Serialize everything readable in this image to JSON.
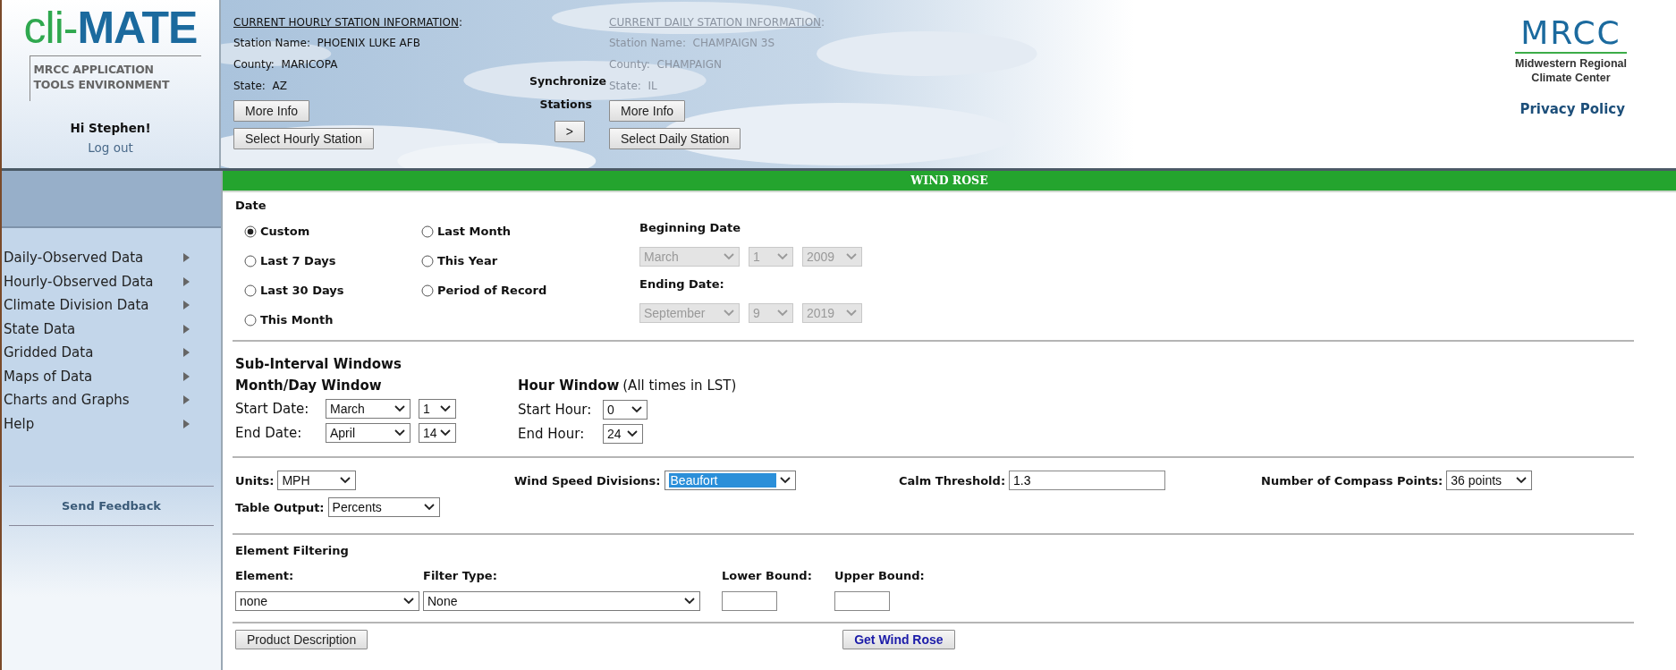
{
  "header": {
    "logo": {
      "prefix": "cli-",
      "main": "MATE"
    },
    "subtitle": [
      "MRCC APPLICATION",
      "TOOLS ENVIRONMENT"
    ],
    "greeting": "Hi Stephen!",
    "logout": "Log out",
    "hourly": {
      "heading": "CURRENT HOURLY STATION INFORMATION",
      "suffix": ":",
      "dimmed": false,
      "fields": [
        {
          "label": "Station Name:",
          "value": "PHOENIX LUKE AFB"
        },
        {
          "label": "County:",
          "value": "MARICOPA"
        },
        {
          "label": "State:",
          "value": "AZ"
        }
      ],
      "buttons": [
        "More Info",
        "Select Hourly Station"
      ]
    },
    "sync": {
      "lines": [
        "Synchronize",
        "Stations"
      ],
      "button": ">"
    },
    "daily": {
      "heading": "CURRENT DAILY STATION INFORMATION",
      "suffix": ":",
      "dimmed": true,
      "fields": [
        {
          "label": "Station Name:",
          "value": "CHAMPAIGN 3S"
        },
        {
          "label": "County:",
          "value": "CHAMPAIGN"
        },
        {
          "label": "State:",
          "value": "IL"
        }
      ],
      "buttons": [
        "More Info",
        "Select Daily Station"
      ]
    },
    "org": {
      "name": "MRCC",
      "lines": [
        "Midwestern Regional",
        "Climate Center"
      ]
    },
    "privacy": "Privacy Policy"
  },
  "sidebar": {
    "items": [
      "Daily-Observed Data",
      "Hourly-Observed Data",
      "Climate Division Data",
      "State Data",
      "Gridded Data",
      "Maps of Data",
      "Charts and Graphs",
      "Help"
    ],
    "feedback": "Send Feedback"
  },
  "title": "WIND ROSE",
  "date": {
    "label": "Date",
    "options": [
      {
        "label": "Custom",
        "selected": true
      },
      {
        "label": "Last 7 Days",
        "selected": false
      },
      {
        "label": "Last 30 Days",
        "selected": false
      },
      {
        "label": "This Month",
        "selected": false
      },
      {
        "label": "Last Month",
        "selected": false
      },
      {
        "label": "This Year",
        "selected": false
      },
      {
        "label": "Period of Record",
        "selected": false
      }
    ],
    "beginning": {
      "label": "Beginning Date",
      "selects": [
        {
          "value": "March",
          "disabled": true
        },
        {
          "value": "1",
          "disabled": true
        },
        {
          "value": "2009",
          "disabled": true
        }
      ]
    },
    "ending": {
      "label": "Ending Date:",
      "selects": [
        {
          "value": "September",
          "disabled": true
        },
        {
          "value": "9",
          "disabled": true
        },
        {
          "value": "2019",
          "disabled": true
        }
      ]
    }
  },
  "subinterval": {
    "title": "Sub-Interval Windows",
    "monthday": {
      "title": "Month/Day Window",
      "rows": [
        {
          "label": "Start Date:",
          "month": {
            "value": "March",
            "disabled": false
          },
          "day": {
            "value": "1",
            "disabled": false
          }
        },
        {
          "label": "End Date:",
          "month": {
            "value": "April",
            "disabled": false
          },
          "day": {
            "value": "14",
            "disabled": false
          }
        }
      ]
    },
    "hour": {
      "title": "Hour Window",
      "note": "(All times in LST)",
      "rows": [
        {
          "label": "Start Hour:",
          "select": {
            "value": "0",
            "disabled": false
          }
        },
        {
          "label": "End Hour:",
          "select": {
            "value": "24",
            "disabled": false
          }
        }
      ]
    }
  },
  "options": {
    "units": {
      "label": "Units:",
      "select": {
        "value": "MPH",
        "disabled": false
      }
    },
    "divisions": {
      "label": "Wind Speed Divisions:",
      "select": {
        "value": "Beaufort",
        "disabled": false,
        "highlighted": true
      }
    },
    "calm": {
      "label": "Calm Threshold:",
      "value": "1.3"
    },
    "compass": {
      "label": "Number of Compass Points:",
      "select": {
        "value": "36 points",
        "disabled": false
      }
    },
    "table": {
      "label": "Table Output:",
      "select": {
        "value": "Percents",
        "disabled": false
      }
    }
  },
  "filtering": {
    "title": "Element Filtering",
    "element": {
      "label": "Element:",
      "select": {
        "value": "none",
        "disabled": false
      }
    },
    "type": {
      "label": "Filter Type:",
      "select": {
        "value": "None",
        "disabled": false
      }
    },
    "lower": {
      "label": "Lower Bound:"
    },
    "upper": {
      "label": "Upper Bound:"
    }
  },
  "actions": [
    "Product Description",
    "Get Wind Rose"
  ]
}
